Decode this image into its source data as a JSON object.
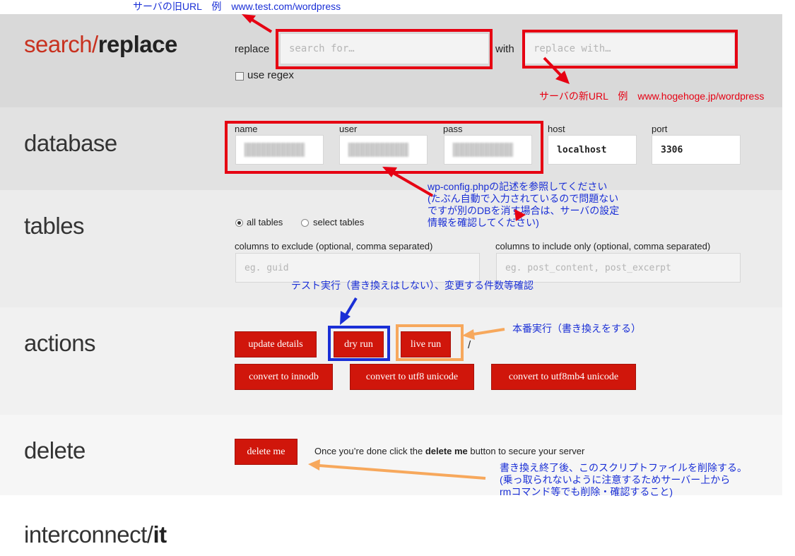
{
  "search_replace": {
    "title_a": "search/",
    "title_b": "replace",
    "replace_label": "replace",
    "search_placeholder": "search for…",
    "with_label": "with",
    "replace_placeholder": "replace with…",
    "regex_label": "use regex"
  },
  "database": {
    "title": "database",
    "name_label": "name",
    "user_label": "user",
    "pass_label": "pass",
    "host_label": "host",
    "host_value": "localhost",
    "port_label": "port",
    "port_value": "3306"
  },
  "tables": {
    "title": "tables",
    "all_tables": "all tables",
    "select_tables": "select tables",
    "exclude_label": "columns to exclude (optional, comma separated)",
    "exclude_placeholder": "eg. guid",
    "include_label": "columns to include only (optional, comma separated)",
    "include_placeholder": "eg. post_content, post_excerpt"
  },
  "actions": {
    "title": "actions",
    "update_details": "update details",
    "dry_run": "dry run",
    "live_run": "live run",
    "slash": "/",
    "convert_innodb": "convert to innodb",
    "convert_utf8": "convert to utf8 unicode",
    "convert_utf8mb4": "convert to utf8mb4 unicode"
  },
  "delete": {
    "title": "delete",
    "delete_me": "delete me",
    "msg_pre": "Once you’re done click the ",
    "msg_bold": "delete me",
    "msg_post": " button to secure your server"
  },
  "footer": {
    "brand_a": "interconnect/",
    "brand_b": "it"
  },
  "annotations": {
    "old_url": "サーバの旧URL　例　www.test.com/wordpress",
    "new_url": "サーバの新URL　例　www.hogehoge.jp/wordpress",
    "db_note": "wp-config.phpの記述を参照してください\n(たぶん自動で入力されているので問題ない\nですが別のDBを消す場合は、サーバの設定\n情報を確認してください)",
    "dry_note": "テスト実行（書き換えはしない）、変更する件数等確認",
    "live_note": "本番実行（書き換えをする）",
    "delete_note": "書き換え終了後、このスクリプトファイルを削除する。\n(乗っ取られないように注意するためサーバー上から\nrmコマンド等でも削除・確認すること)"
  },
  "colors": {
    "button_red": "#d0160b",
    "annotation_red": "#e60012",
    "annotation_blue": "#1a2fd6",
    "annotation_orange": "#f7a85c",
    "band_gray": "#d9d9d9"
  }
}
